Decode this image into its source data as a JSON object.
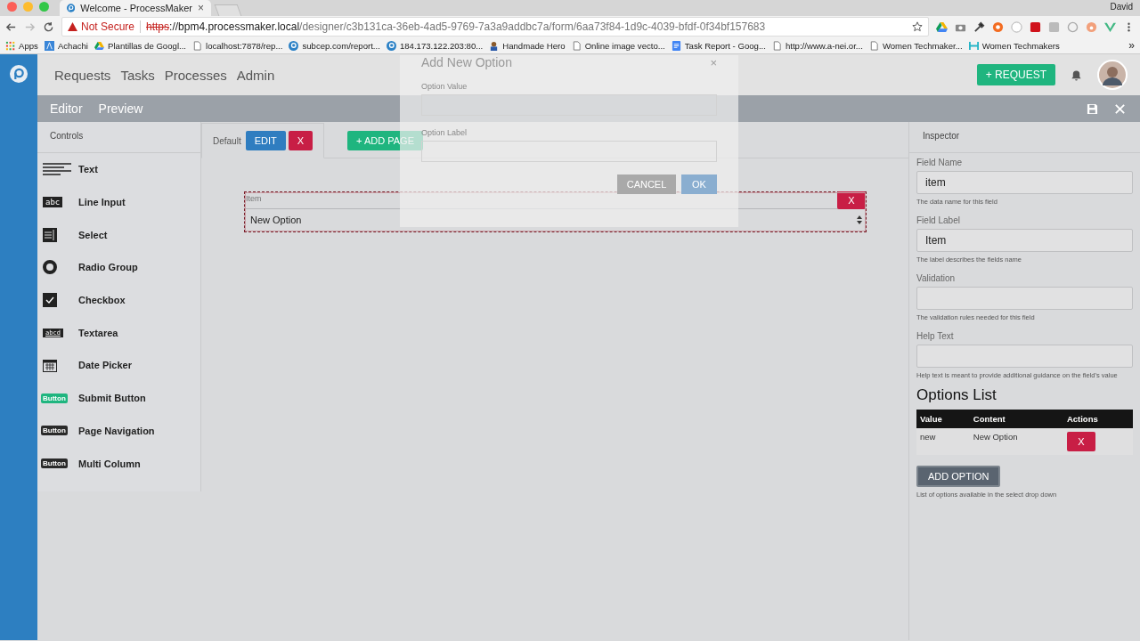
{
  "browser": {
    "tab_title": "Welcome - ProcessMaker",
    "tab_close": "×",
    "user": "David",
    "security": "Not Secure",
    "url_scheme": "https",
    "url_rest": "://bpm4.processmaker.local",
    "url_path": "/designer/c3b131ca-36eb-4ad5-9769-7a3a9addbc7a/form/6aa73f84-1d9c-4039-bfdf-0f34bf157683",
    "more_bookmarks": "»",
    "bookmarks": [
      {
        "label": "Apps",
        "kind": "apps"
      },
      {
        "label": "Achachi",
        "kind": "app"
      },
      {
        "label": "Plantillas de Googl...",
        "kind": "drive"
      },
      {
        "label": "localhost:7878/rep...",
        "kind": "page"
      },
      {
        "label": "subcep.com/report...",
        "kind": "pm"
      },
      {
        "label": "184.173.122.203:80...",
        "kind": "pm"
      },
      {
        "label": "Handmade Hero",
        "kind": "hero"
      },
      {
        "label": "Online image vecto...",
        "kind": "page"
      },
      {
        "label": "Task Report - Goog...",
        "kind": "doc"
      },
      {
        "label": "http://www.a-nei.or...",
        "kind": "page"
      },
      {
        "label": "Women Techmaker...",
        "kind": "page"
      },
      {
        "label": "Women Techmakers",
        "kind": "wt"
      }
    ]
  },
  "nav": {
    "items": [
      "Requests",
      "Tasks",
      "Processes",
      "Admin"
    ],
    "request_button": "+ REQUEST"
  },
  "editor_bar": {
    "tabs": [
      "Editor",
      "Preview"
    ]
  },
  "controls": {
    "title": "Controls",
    "items": [
      {
        "label": "Text",
        "kind": "text"
      },
      {
        "label": "Line Input",
        "kind": "input",
        "icon_text": "abc"
      },
      {
        "label": "Select",
        "kind": "select"
      },
      {
        "label": "Radio Group",
        "kind": "radio"
      },
      {
        "label": "Checkbox",
        "kind": "checkbox"
      },
      {
        "label": "Textarea",
        "kind": "textarea",
        "icon_text": "abcd"
      },
      {
        "label": "Date Picker",
        "kind": "date"
      },
      {
        "label": "Submit Button",
        "kind": "button",
        "icon_text": "Button",
        "color": "#1fb57f"
      },
      {
        "label": "Page Navigation",
        "kind": "button",
        "icon_text": "Button",
        "color": "#2a2a2a"
      },
      {
        "label": "Multi Column",
        "kind": "button",
        "icon_text": "Button",
        "color": "#2a2a2a"
      }
    ]
  },
  "canvas": {
    "page_tab": "Default",
    "edit": "EDIT",
    "delete": "X",
    "add_page": "+ ADD PAGE",
    "field": {
      "label": "Item",
      "value": "New Option",
      "delete": "X"
    }
  },
  "inspector": {
    "title": "Inspector",
    "fields": [
      {
        "label": "Field Name",
        "value": "item",
        "help": "The data name for this field"
      },
      {
        "label": "Field Label",
        "value": "Item",
        "help": "The label describes the fields name"
      },
      {
        "label": "Validation",
        "help": "The validation rules needed for this field"
      },
      {
        "label": "Help Text",
        "help": "Help text is meant to provide additional guidance on the field's value"
      }
    ],
    "options_title": "Options List",
    "columns": [
      "Value",
      "Content",
      "Actions"
    ],
    "rows": [
      {
        "value": "new",
        "content": "New Option",
        "action": "X"
      }
    ],
    "add_option": "ADD OPTION",
    "options_help": "List of options available in the select drop down"
  },
  "modal": {
    "title": "Add New Option",
    "close": "×",
    "fields": [
      "Option Value",
      "Option Label"
    ],
    "cancel": "CANCEL",
    "ok": "OK"
  }
}
